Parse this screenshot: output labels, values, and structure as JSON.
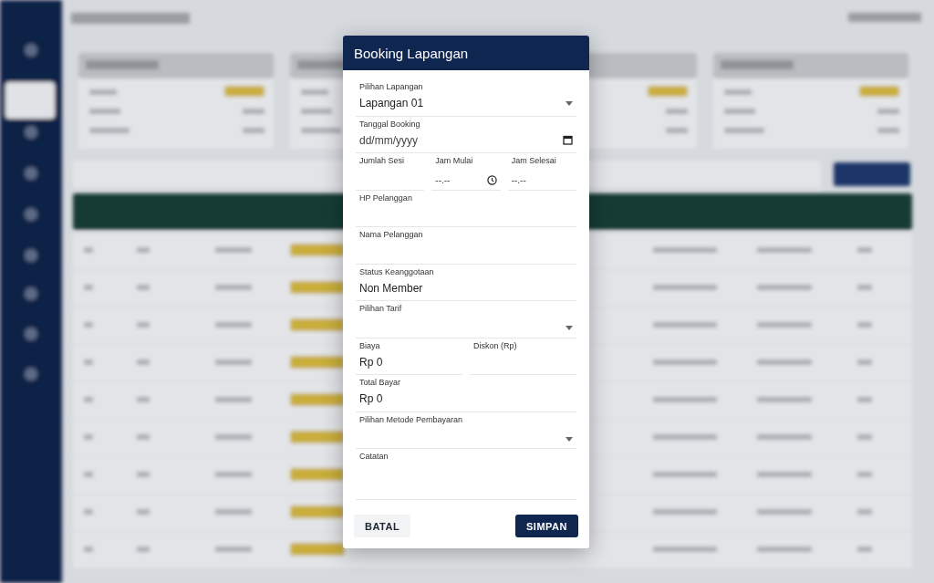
{
  "dialog": {
    "title": "Booking Lapangan",
    "rows": [
      [
        {
          "kind": "select",
          "label": "Pilihan Lapangan",
          "value": "Lapangan 01"
        }
      ],
      [
        {
          "kind": "date",
          "label": "Tanggal Booking",
          "placeholder": "dd/mm/yyyy"
        }
      ],
      [
        {
          "kind": "text",
          "label": "Jumlah Sesi"
        },
        {
          "kind": "time",
          "label": "Jam Mulai",
          "placeholder": "--.--",
          "clock_icon": true
        },
        {
          "kind": "time",
          "label": "Jam Selesai",
          "placeholder": "--.--",
          "clock_icon": false
        }
      ],
      [
        {
          "kind": "text",
          "label": "HP Pelanggan"
        }
      ],
      [
        {
          "kind": "text",
          "label": "Nama Pelanggan"
        }
      ],
      [
        {
          "kind": "text",
          "label": "Status Keanggotaan",
          "value": "Non Member"
        }
      ],
      [
        {
          "kind": "select",
          "label": "Pilihan Tarif"
        }
      ],
      [
        {
          "kind": "text",
          "label": "Biaya",
          "value": "Rp 0"
        },
        {
          "kind": "text",
          "label": "Diskon (Rp)"
        }
      ],
      [
        {
          "kind": "text",
          "label": "Total Bayar",
          "value": "Rp 0"
        }
      ],
      [
        {
          "kind": "select",
          "label": "Pilihan Metode Pembayaran"
        }
      ],
      [
        {
          "kind": "textarea",
          "label": "Catatan"
        }
      ]
    ],
    "buttons": [
      {
        "kind": "text",
        "label": "BATAL"
      },
      {
        "kind": "primary",
        "label": "SIMPAN"
      }
    ]
  }
}
